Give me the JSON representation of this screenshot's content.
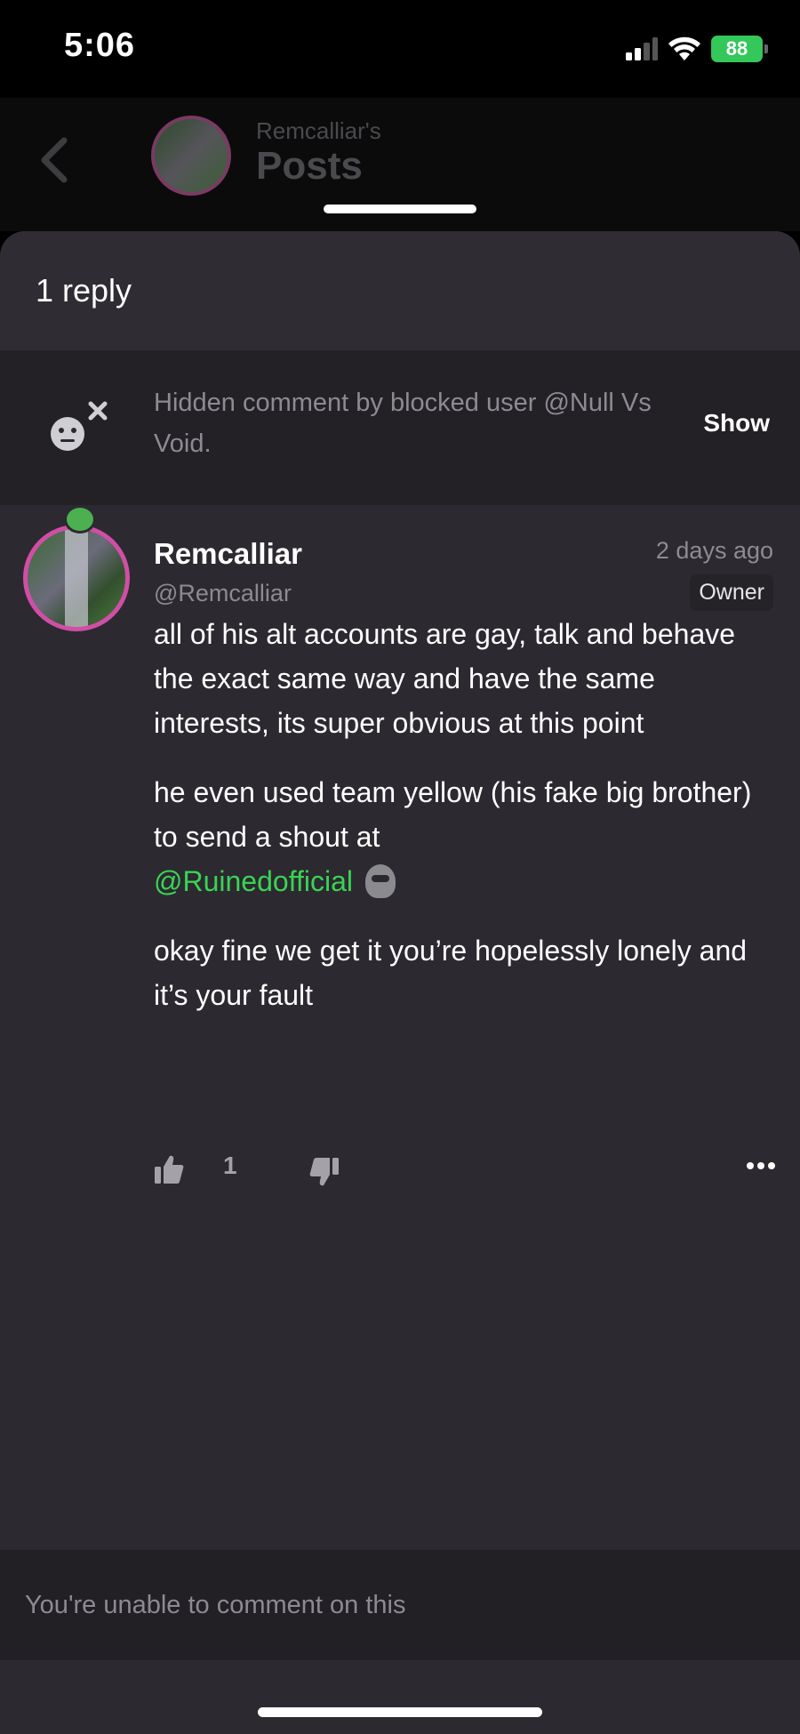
{
  "status_bar": {
    "time": "5:06",
    "battery": "88",
    "icons": [
      "signal-icon",
      "wifi-icon",
      "battery-icon"
    ]
  },
  "header": {
    "subtitle": "Remcalliar's",
    "title": "Posts"
  },
  "sheet": {
    "reply_count": "1 reply",
    "hidden_comment": {
      "text": "Hidden comment by blocked user @Null Vs Void.",
      "show_label": "Show"
    },
    "comment": {
      "username": "Remcalliar",
      "handle": "@Remcalliar",
      "timestamp": "2 days ago",
      "badge": "Owner",
      "paragraphs": [
        "all of his alt accounts are gay, talk and behave the exact same way and have the same interests, its super obvious at this point",
        "he even used team yellow (his fake big brother) to send a shout at",
        "okay fine we get it you’re hopelessly lonely and it’s your fault"
      ],
      "mention": "@Ruinedofficial",
      "like_count": "1"
    },
    "footer_text": "You're unable to comment on this"
  },
  "colors": {
    "background": "#2c2930",
    "mention": "#39d353",
    "avatar_ring": "#d04ea6",
    "battery": "#34c759"
  }
}
